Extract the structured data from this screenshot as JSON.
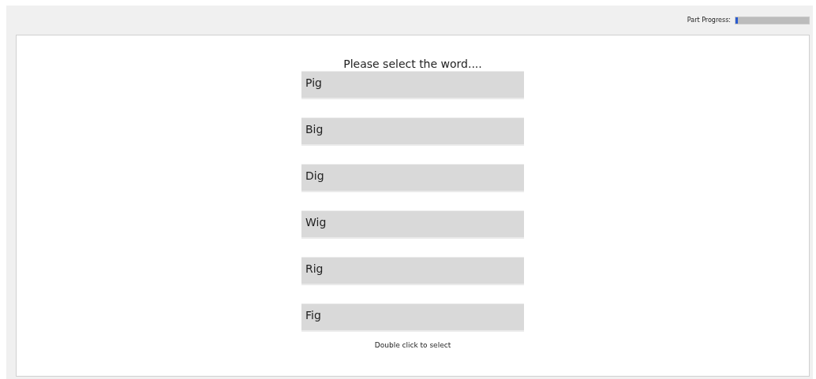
{
  "progress": {
    "label": "Part Progress:",
    "level": 0.03
  },
  "prompt": "Please select the word....",
  "options": [
    "Pig",
    "Big",
    "Dig",
    "Wig",
    "Rig",
    "Fig"
  ],
  "hint": "Double click to select"
}
